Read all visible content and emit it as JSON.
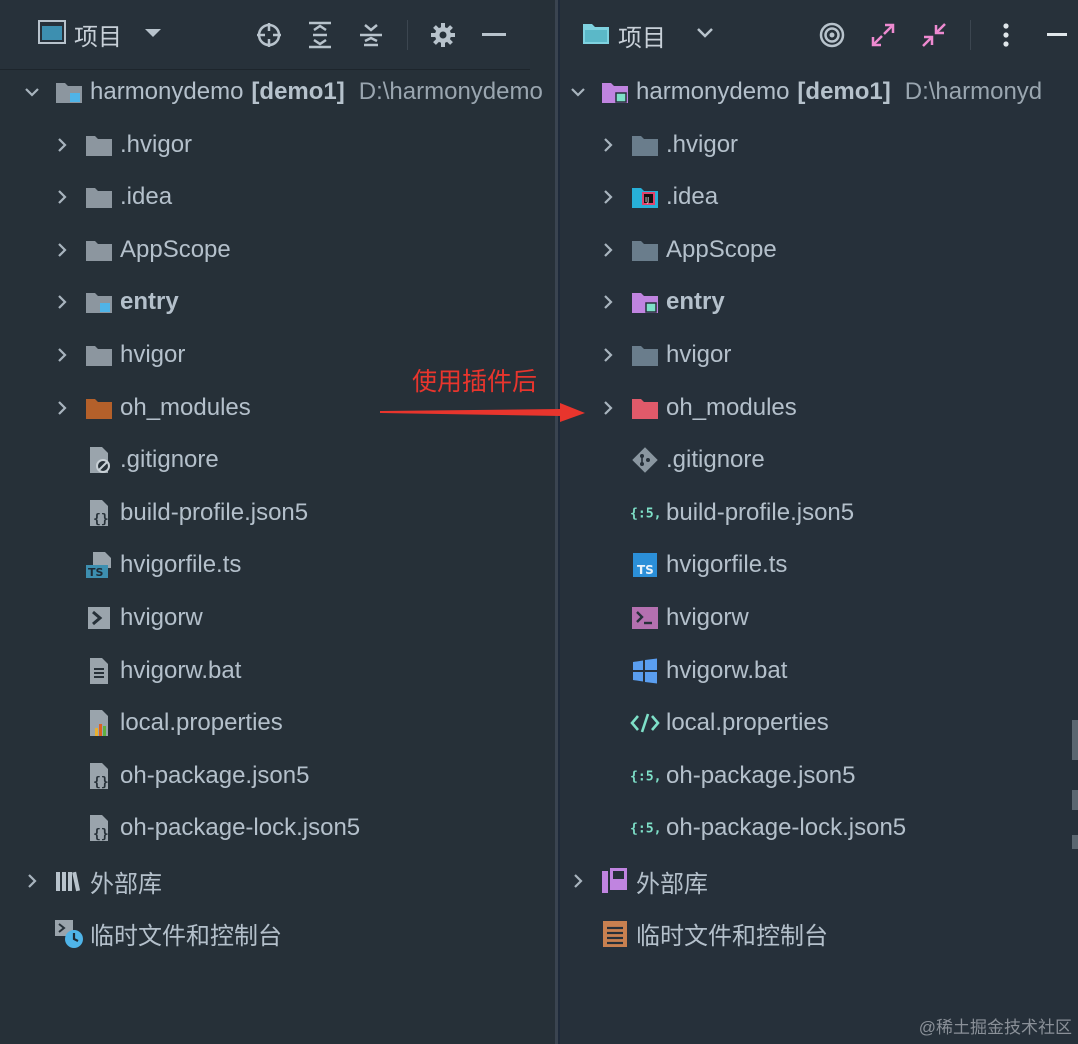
{
  "left": {
    "toolbar": {
      "title": "项目",
      "icons": [
        "project-view-icon",
        "dropdown-caret-icon",
        "locate-icon",
        "expand-all-icon",
        "collapse-all-icon",
        "settings-icon",
        "minimize-icon"
      ]
    },
    "root": {
      "name": "harmonydemo",
      "module": "[demo1]",
      "path": "D:\\harmonydemo"
    },
    "items": [
      {
        "label": ".hvigor",
        "type": "folder",
        "expandable": true
      },
      {
        "label": ".idea",
        "type": "folder",
        "expandable": true
      },
      {
        "label": "AppScope",
        "type": "folder",
        "expandable": true
      },
      {
        "label": "entry",
        "type": "module-folder",
        "expandable": true,
        "bold": true
      },
      {
        "label": "hvigor",
        "type": "folder",
        "expandable": true
      },
      {
        "label": "oh_modules",
        "type": "excluded-folder",
        "expandable": true
      },
      {
        "label": ".gitignore",
        "type": "ignore-file",
        "expandable": false
      },
      {
        "label": "build-profile.json5",
        "type": "json-file",
        "expandable": false
      },
      {
        "label": "hvigorfile.ts",
        "type": "ts-file",
        "expandable": false
      },
      {
        "label": "hvigorw",
        "type": "shell-file",
        "expandable": false
      },
      {
        "label": "hvigorw.bat",
        "type": "text-file",
        "expandable": false
      },
      {
        "label": "local.properties",
        "type": "properties-file",
        "expandable": false
      },
      {
        "label": "oh-package.json5",
        "type": "json-file",
        "expandable": false
      },
      {
        "label": "oh-package-lock.json5",
        "type": "json-file",
        "expandable": false
      }
    ],
    "external_libraries": "外部库",
    "scratches": "临时文件和控制台"
  },
  "right": {
    "toolbar": {
      "title": "项目",
      "icons": [
        "folder-icon",
        "chevron-down-icon",
        "target-icon",
        "expand-icon",
        "collapse-icon",
        "more-options-icon",
        "minimize-icon"
      ]
    },
    "root": {
      "name": "harmonydemo",
      "module": "[demo1]",
      "path": "D:\\harmonyd"
    },
    "items": [
      {
        "label": ".hvigor",
        "type": "folder",
        "expandable": true
      },
      {
        "label": ".idea",
        "type": "idea-folder",
        "expandable": true
      },
      {
        "label": "AppScope",
        "type": "folder",
        "expandable": true
      },
      {
        "label": "entry",
        "type": "module-folder",
        "expandable": true,
        "bold": true
      },
      {
        "label": "hvigor",
        "type": "folder",
        "expandable": true
      },
      {
        "label": "oh_modules",
        "type": "excluded-folder",
        "expandable": true
      },
      {
        "label": ".gitignore",
        "type": "git-file",
        "expandable": false
      },
      {
        "label": "build-profile.json5",
        "type": "json5-file",
        "expandable": false
      },
      {
        "label": "hvigorfile.ts",
        "type": "ts-file",
        "expandable": false
      },
      {
        "label": "hvigorw",
        "type": "console-file",
        "expandable": false
      },
      {
        "label": "hvigorw.bat",
        "type": "windows-file",
        "expandable": false
      },
      {
        "label": "local.properties",
        "type": "code-file",
        "expandable": false
      },
      {
        "label": "oh-package.json5",
        "type": "json5-file",
        "expandable": false
      },
      {
        "label": "oh-package-lock.json5",
        "type": "json5-file",
        "expandable": false
      }
    ],
    "external_libraries": "外部库",
    "scratches": "临时文件和控制台"
  },
  "annotation": {
    "text": "使用插件后",
    "color": "#e8352d"
  },
  "watermark": "@稀土掘金技术社区",
  "colors": {
    "accent_red": "#e8352d",
    "folder_left": "#8c969f",
    "folder_right": "#6a7d8c",
    "module_purple": "#c084e0"
  }
}
